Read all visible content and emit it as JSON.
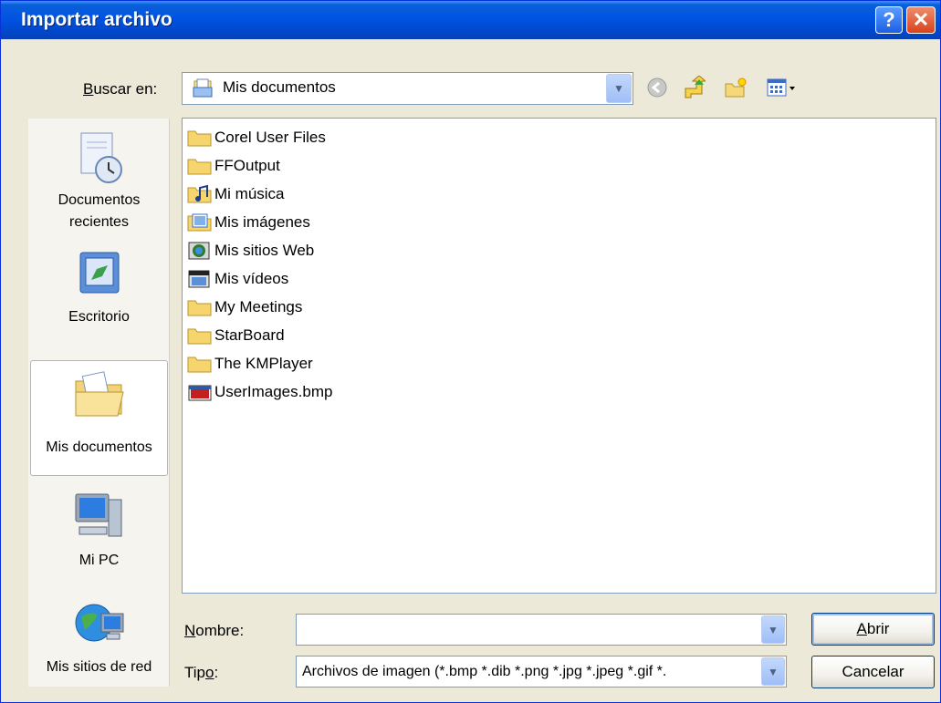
{
  "window": {
    "title": "Importar archivo"
  },
  "titlebar": {
    "help_glyph": "?",
    "close_glyph": "✕"
  },
  "look_in": {
    "label_prefix": "B",
    "label_rest": "uscar en:",
    "value": "Mis documentos"
  },
  "places": [
    {
      "label": "Documentos recientes",
      "icon": "recent-documents-icon"
    },
    {
      "label": "Escritorio",
      "icon": "desktop-icon"
    },
    {
      "label": "Mis documentos",
      "icon": "my-documents-icon",
      "selected": true
    },
    {
      "label": "Mi PC",
      "icon": "my-computer-icon"
    },
    {
      "label": "Mis sitios de red",
      "icon": "network-places-icon"
    }
  ],
  "files": [
    {
      "name": "Corel User Files",
      "icon": "folder-icon"
    },
    {
      "name": "FFOutput",
      "icon": "folder-icon"
    },
    {
      "name": "Mi música",
      "icon": "music-folder-icon"
    },
    {
      "name": "Mis imágenes",
      "icon": "pictures-folder-icon"
    },
    {
      "name": "Mis sitios Web",
      "icon": "web-folder-icon"
    },
    {
      "name": "Mis vídeos",
      "icon": "video-folder-icon"
    },
    {
      "name": "My Meetings",
      "icon": "folder-icon"
    },
    {
      "name": "StarBoard",
      "icon": "folder-icon"
    },
    {
      "name": "The KMPlayer",
      "icon": "folder-icon"
    },
    {
      "name": "UserImages.bmp",
      "icon": "bmp-file-icon"
    }
  ],
  "filename": {
    "label_prefix": "N",
    "label_rest": "ombre:",
    "value": ""
  },
  "filetype": {
    "label_prefix": "Tip",
    "label_underlined": "o",
    "label_rest": ":",
    "value": "Archivos de imagen (*.bmp *.dib *.png *.jpg *.jpeg *.gif *."
  },
  "buttons": {
    "open_prefix": "A",
    "open_rest": "brir",
    "cancel": "Cancelar"
  },
  "colors": {
    "titlebar": "#0054e3",
    "dialog_bg": "#ece9d8",
    "border": "#7f9db9"
  }
}
